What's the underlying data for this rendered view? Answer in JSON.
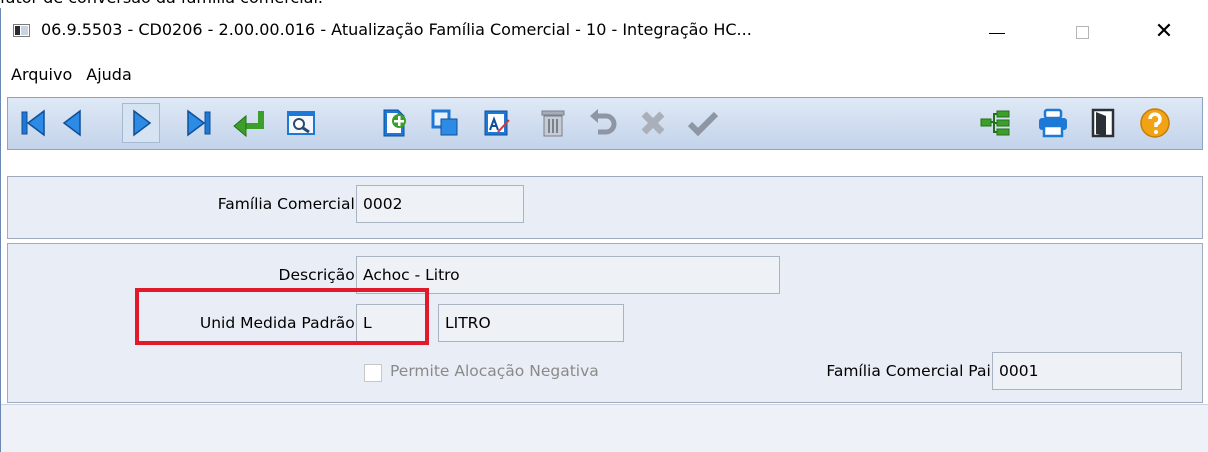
{
  "page": {
    "cutoff_text": "fator de conversão da família comercial."
  },
  "window": {
    "title": "06.9.5503 - CD0206 - 2.00.00.016 - Atualização Família Comercial - 10 - Integração HC...",
    "minimize_icon": "minimize-icon",
    "maximize_icon": "maximize-icon",
    "close_icon": "close-icon",
    "close_glyph": "✕"
  },
  "menu": {
    "items": [
      {
        "label": "Arquivo"
      },
      {
        "label": "Ajuda"
      }
    ]
  },
  "toolbar": {
    "buttons": [
      {
        "icon": "first-record-icon"
      },
      {
        "icon": "previous-record-icon"
      },
      {
        "icon": "next-record-icon"
      },
      {
        "icon": "last-record-icon"
      },
      {
        "icon": "goto-enter-icon"
      },
      {
        "icon": "search-icon"
      },
      {
        "icon": "new-record-icon"
      },
      {
        "icon": "copy-icon"
      },
      {
        "icon": "edit-icon"
      },
      {
        "icon": "delete-icon"
      },
      {
        "icon": "undo-icon"
      },
      {
        "icon": "cancel-icon"
      },
      {
        "icon": "confirm-icon"
      },
      {
        "icon": "tree-icon"
      },
      {
        "icon": "print-icon"
      },
      {
        "icon": "exit-icon"
      },
      {
        "icon": "help-icon"
      }
    ],
    "colors": {
      "blue": "#1d78d6",
      "green": "#3c9f2a",
      "gray": "#8d96a2",
      "orange": "#f2a315"
    }
  },
  "form": {
    "familia_comercial": {
      "label": "Família Comercial:",
      "value": "0002"
    },
    "descricao": {
      "label": "Descrição:",
      "value": "Achoc - Litro"
    },
    "unid_medida": {
      "label": "Unid Medida Padrão:",
      "value": "L",
      "description": "LITRO"
    },
    "permite_alocacao": {
      "label": "Permite Alocação Negativa",
      "checked": false,
      "disabled": true
    },
    "familia_pai": {
      "label": "Família Comercial Pai:",
      "value": "0001"
    }
  },
  "highlight": {
    "color": "#e01a2a",
    "target": "unid-medida-padrao"
  }
}
